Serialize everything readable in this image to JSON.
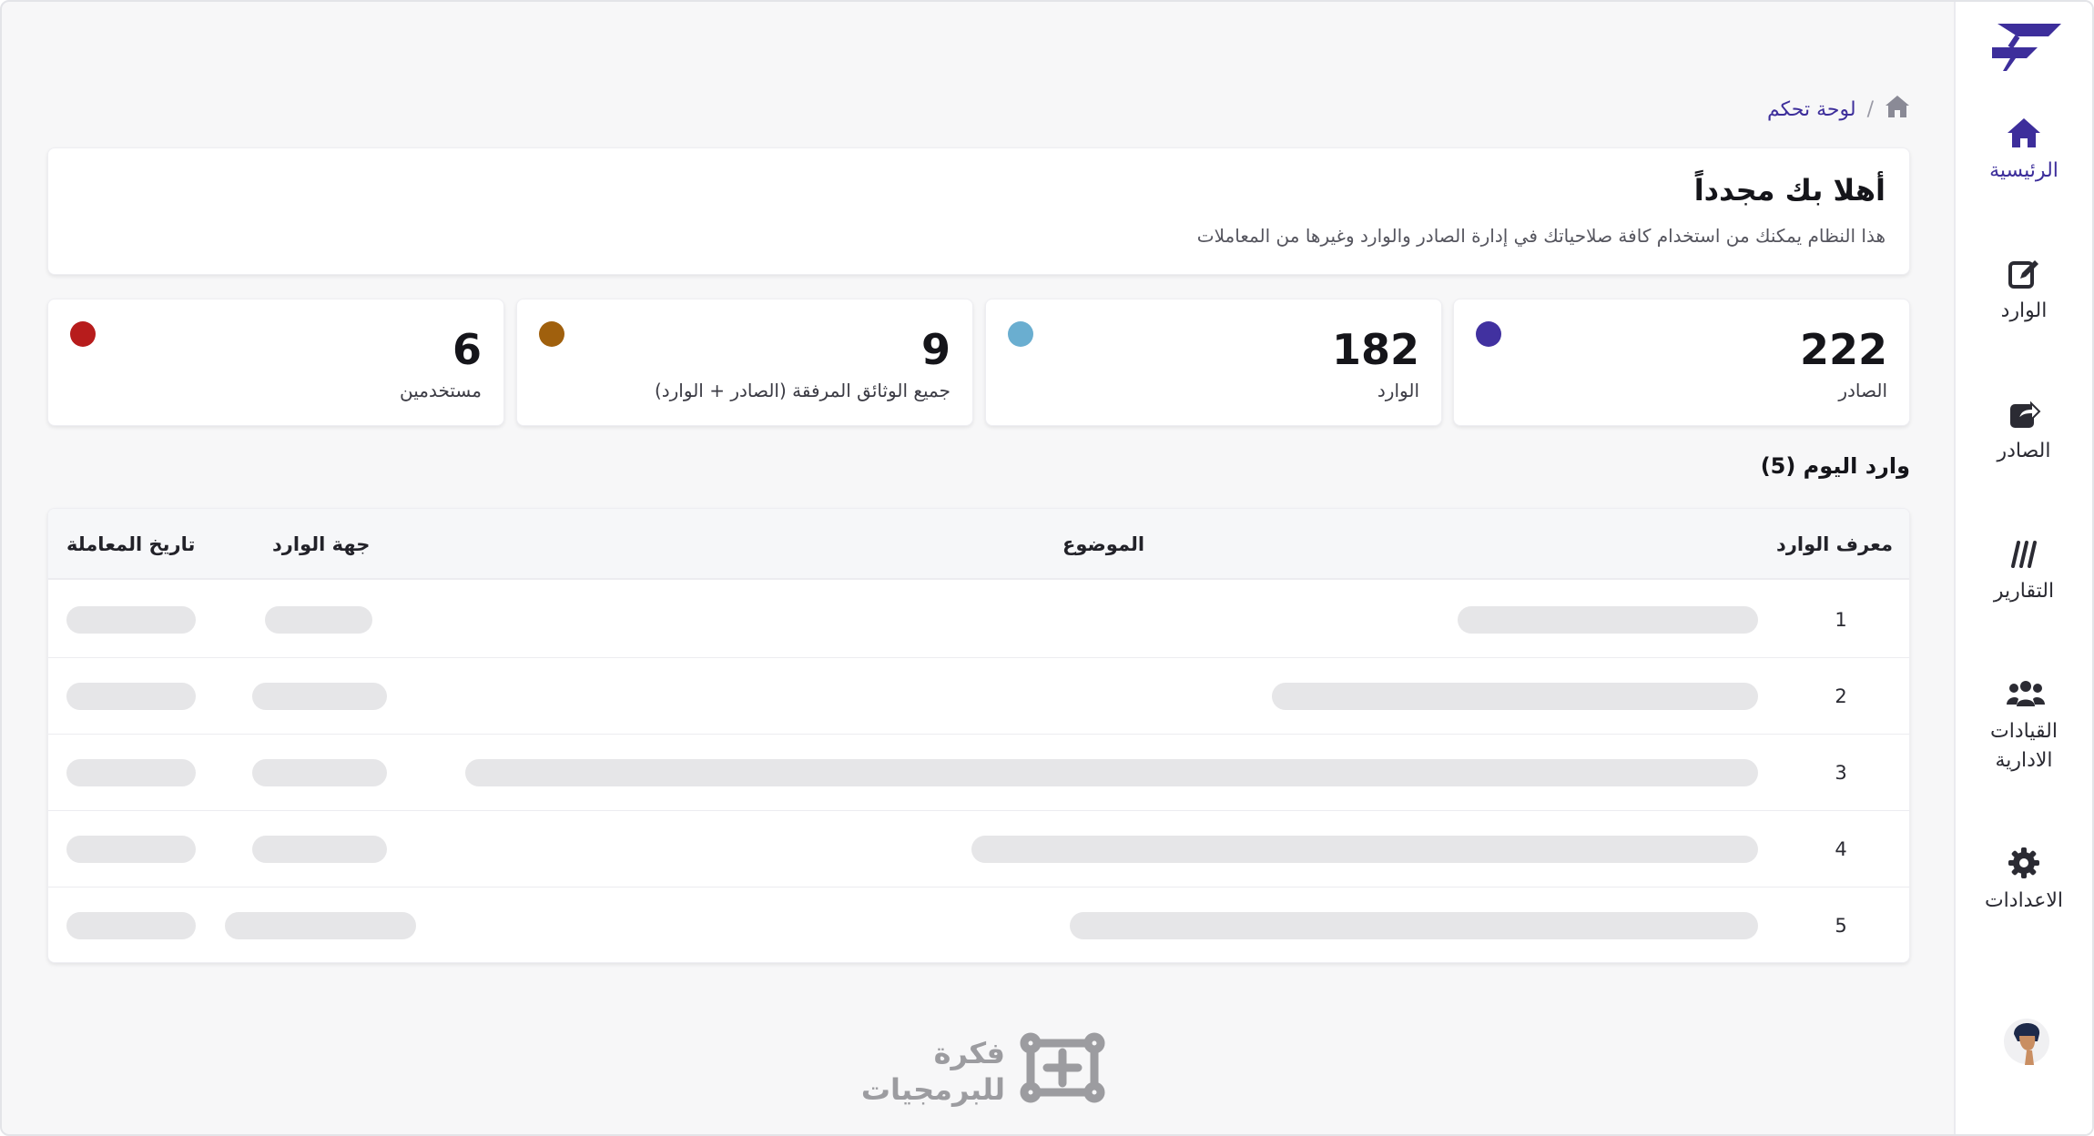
{
  "sidebar": {
    "items": [
      {
        "label": "الرئيسية",
        "icon": "home-icon",
        "active": true
      },
      {
        "label": "الوارد",
        "icon": "edit-icon"
      },
      {
        "label": "الصادر",
        "icon": "share-icon"
      },
      {
        "label": "التقارير",
        "icon": "reports-icon"
      },
      {
        "label": "القيادات الادارية",
        "icon": "users-icon"
      },
      {
        "label": "الاعدادات",
        "icon": "gear-icon"
      }
    ],
    "accent": "#3d2e9b"
  },
  "breadcrumb": {
    "home_icon": "home-icon",
    "separator": "/",
    "current": "لوحة تحكم"
  },
  "welcome": {
    "title": "أهلا بك مجدداً",
    "subtitle": "هذا النظام يمكنك من استخدام كافة صلاحياتك في إدارة الصادر والوارد وغيرها من المعاملات"
  },
  "stats": [
    {
      "value": "222",
      "label": "الصادر",
      "color": "#4131a0"
    },
    {
      "value": "182",
      "label": "الوارد",
      "color": "#6aaed0"
    },
    {
      "value": "9",
      "label": "جميع الوثائق المرفقة (الصادر + الوارد)",
      "color": "#a0600d"
    },
    {
      "value": "6",
      "label": "مستخدمين",
      "color": "#b71c1c"
    }
  ],
  "today": {
    "title": "وارد اليوم (5)",
    "columns": [
      "معرف الوارد",
      "الموضوع",
      "جهة الوارد",
      "تاريخ المعاملة"
    ],
    "rows": [
      {
        "id": "1"
      },
      {
        "id": "2"
      },
      {
        "id": "3"
      },
      {
        "id": "4"
      },
      {
        "id": "5"
      }
    ]
  },
  "brand": {
    "line1": "فكرة",
    "line2": "للبرمجيات"
  }
}
